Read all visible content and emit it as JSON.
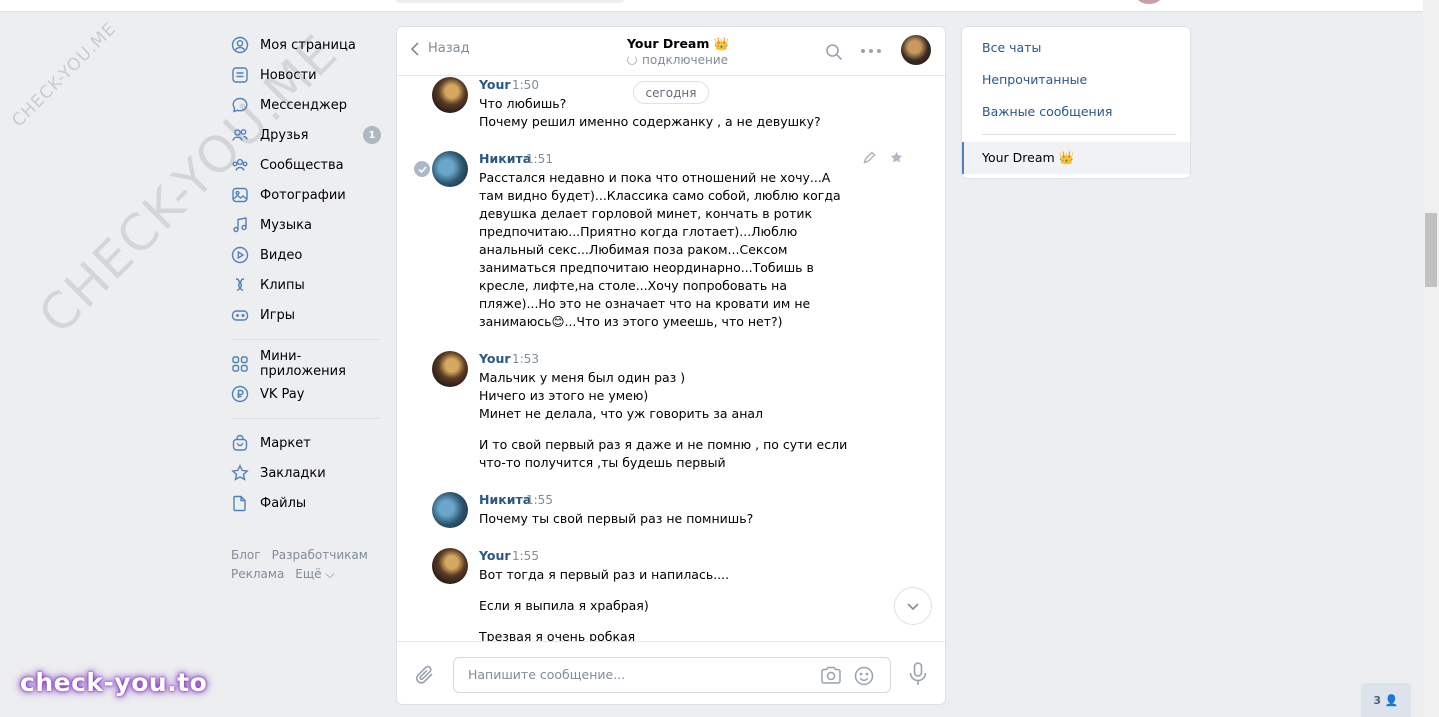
{
  "watermark": {
    "small": "CHECK-YOU.ME",
    "big": "CHECK-YOU.ME",
    "bottom": "check-you.to"
  },
  "nav": {
    "items": [
      {
        "label": "Моя страница",
        "icon": "user-circle-icon"
      },
      {
        "label": "Новости",
        "icon": "news-icon"
      },
      {
        "label": "Мессенджер",
        "icon": "chat-bubble-icon"
      },
      {
        "label": "Друзья",
        "icon": "friends-icon",
        "badge": "1"
      },
      {
        "label": "Сообщества",
        "icon": "communities-icon"
      },
      {
        "label": "Фотографии",
        "icon": "photo-icon"
      },
      {
        "label": "Музыка",
        "icon": "music-note-icon"
      },
      {
        "label": "Видео",
        "icon": "play-circle-icon"
      },
      {
        "label": "Клипы",
        "icon": "clips-icon"
      },
      {
        "label": "Игры",
        "icon": "gamepad-icon"
      }
    ],
    "items2": [
      {
        "label": "Мини-приложения",
        "icon": "apps-grid-icon"
      },
      {
        "label": "VK Pay",
        "icon": "ruble-icon"
      }
    ],
    "items3": [
      {
        "label": "Маркет",
        "icon": "bag-icon"
      },
      {
        "label": "Закладки",
        "icon": "star-icon"
      },
      {
        "label": "Файлы",
        "icon": "file-icon"
      }
    ],
    "footer": {
      "blog": "Блог",
      "developers": "Разработчикам",
      "ads": "Реклама",
      "more": "Ещё ⌵"
    }
  },
  "chat": {
    "back_label": "Назад",
    "peer_name": "Your Dream 👑",
    "peer_status": "подключение",
    "date_pill": "сегодня",
    "messages": [
      {
        "author": "Your",
        "time": "1:50",
        "lines": [
          "Что любишь?",
          "Почему решил именно содержанку , а не девушку?"
        ]
      },
      {
        "author": "Никита",
        "time": "1:51",
        "lines": [
          "Расстался недавно и пока что отношений не хочу...А там видно будет)...Классика само собой, люблю когда девушка делает горловой минет, кончать в ротик предпочитаю...Приятно когда глотает)...Люблю анальный секс...Любимая поза раком...Сексом заниматься предпочитаю неординарно...Тобишь в кресле, лифте,на столе...Хочу попробовать на пляже)...Но это не означает что на кровати им не занимаюсь😊...Что из этого умеешь, что нет?)"
        ]
      },
      {
        "author": "Your",
        "time": "1:53",
        "lines": [
          "Мальчик у меня был один раз )",
          "Ничего из этого не умею)",
          "Минет не делала, что уж говорить за анал"
        ],
        "extra": "И то свой первый раз я даже и не помню , по сути если что-то получится ,ты будешь первый"
      },
      {
        "author": "Никита",
        "time": "1:55",
        "lines": [
          "Почему ты свой первый раз не помнишь?"
        ]
      },
      {
        "author": "Your",
        "time": "1:55",
        "lines": [
          "Вот тогда я первый раз и напилась...."
        ],
        "extra": "Если я выпила я храбрая)",
        "extra2": "Трезвая я очень робкая"
      }
    ],
    "composer_placeholder": "Напишите сообщение..."
  },
  "right_panel": {
    "all_chats": "Все чаты",
    "unread": "Непрочитанные",
    "important": "Важные сообщения",
    "active_chat": "Your Dream 👑"
  },
  "online_badge": "3 👤"
}
